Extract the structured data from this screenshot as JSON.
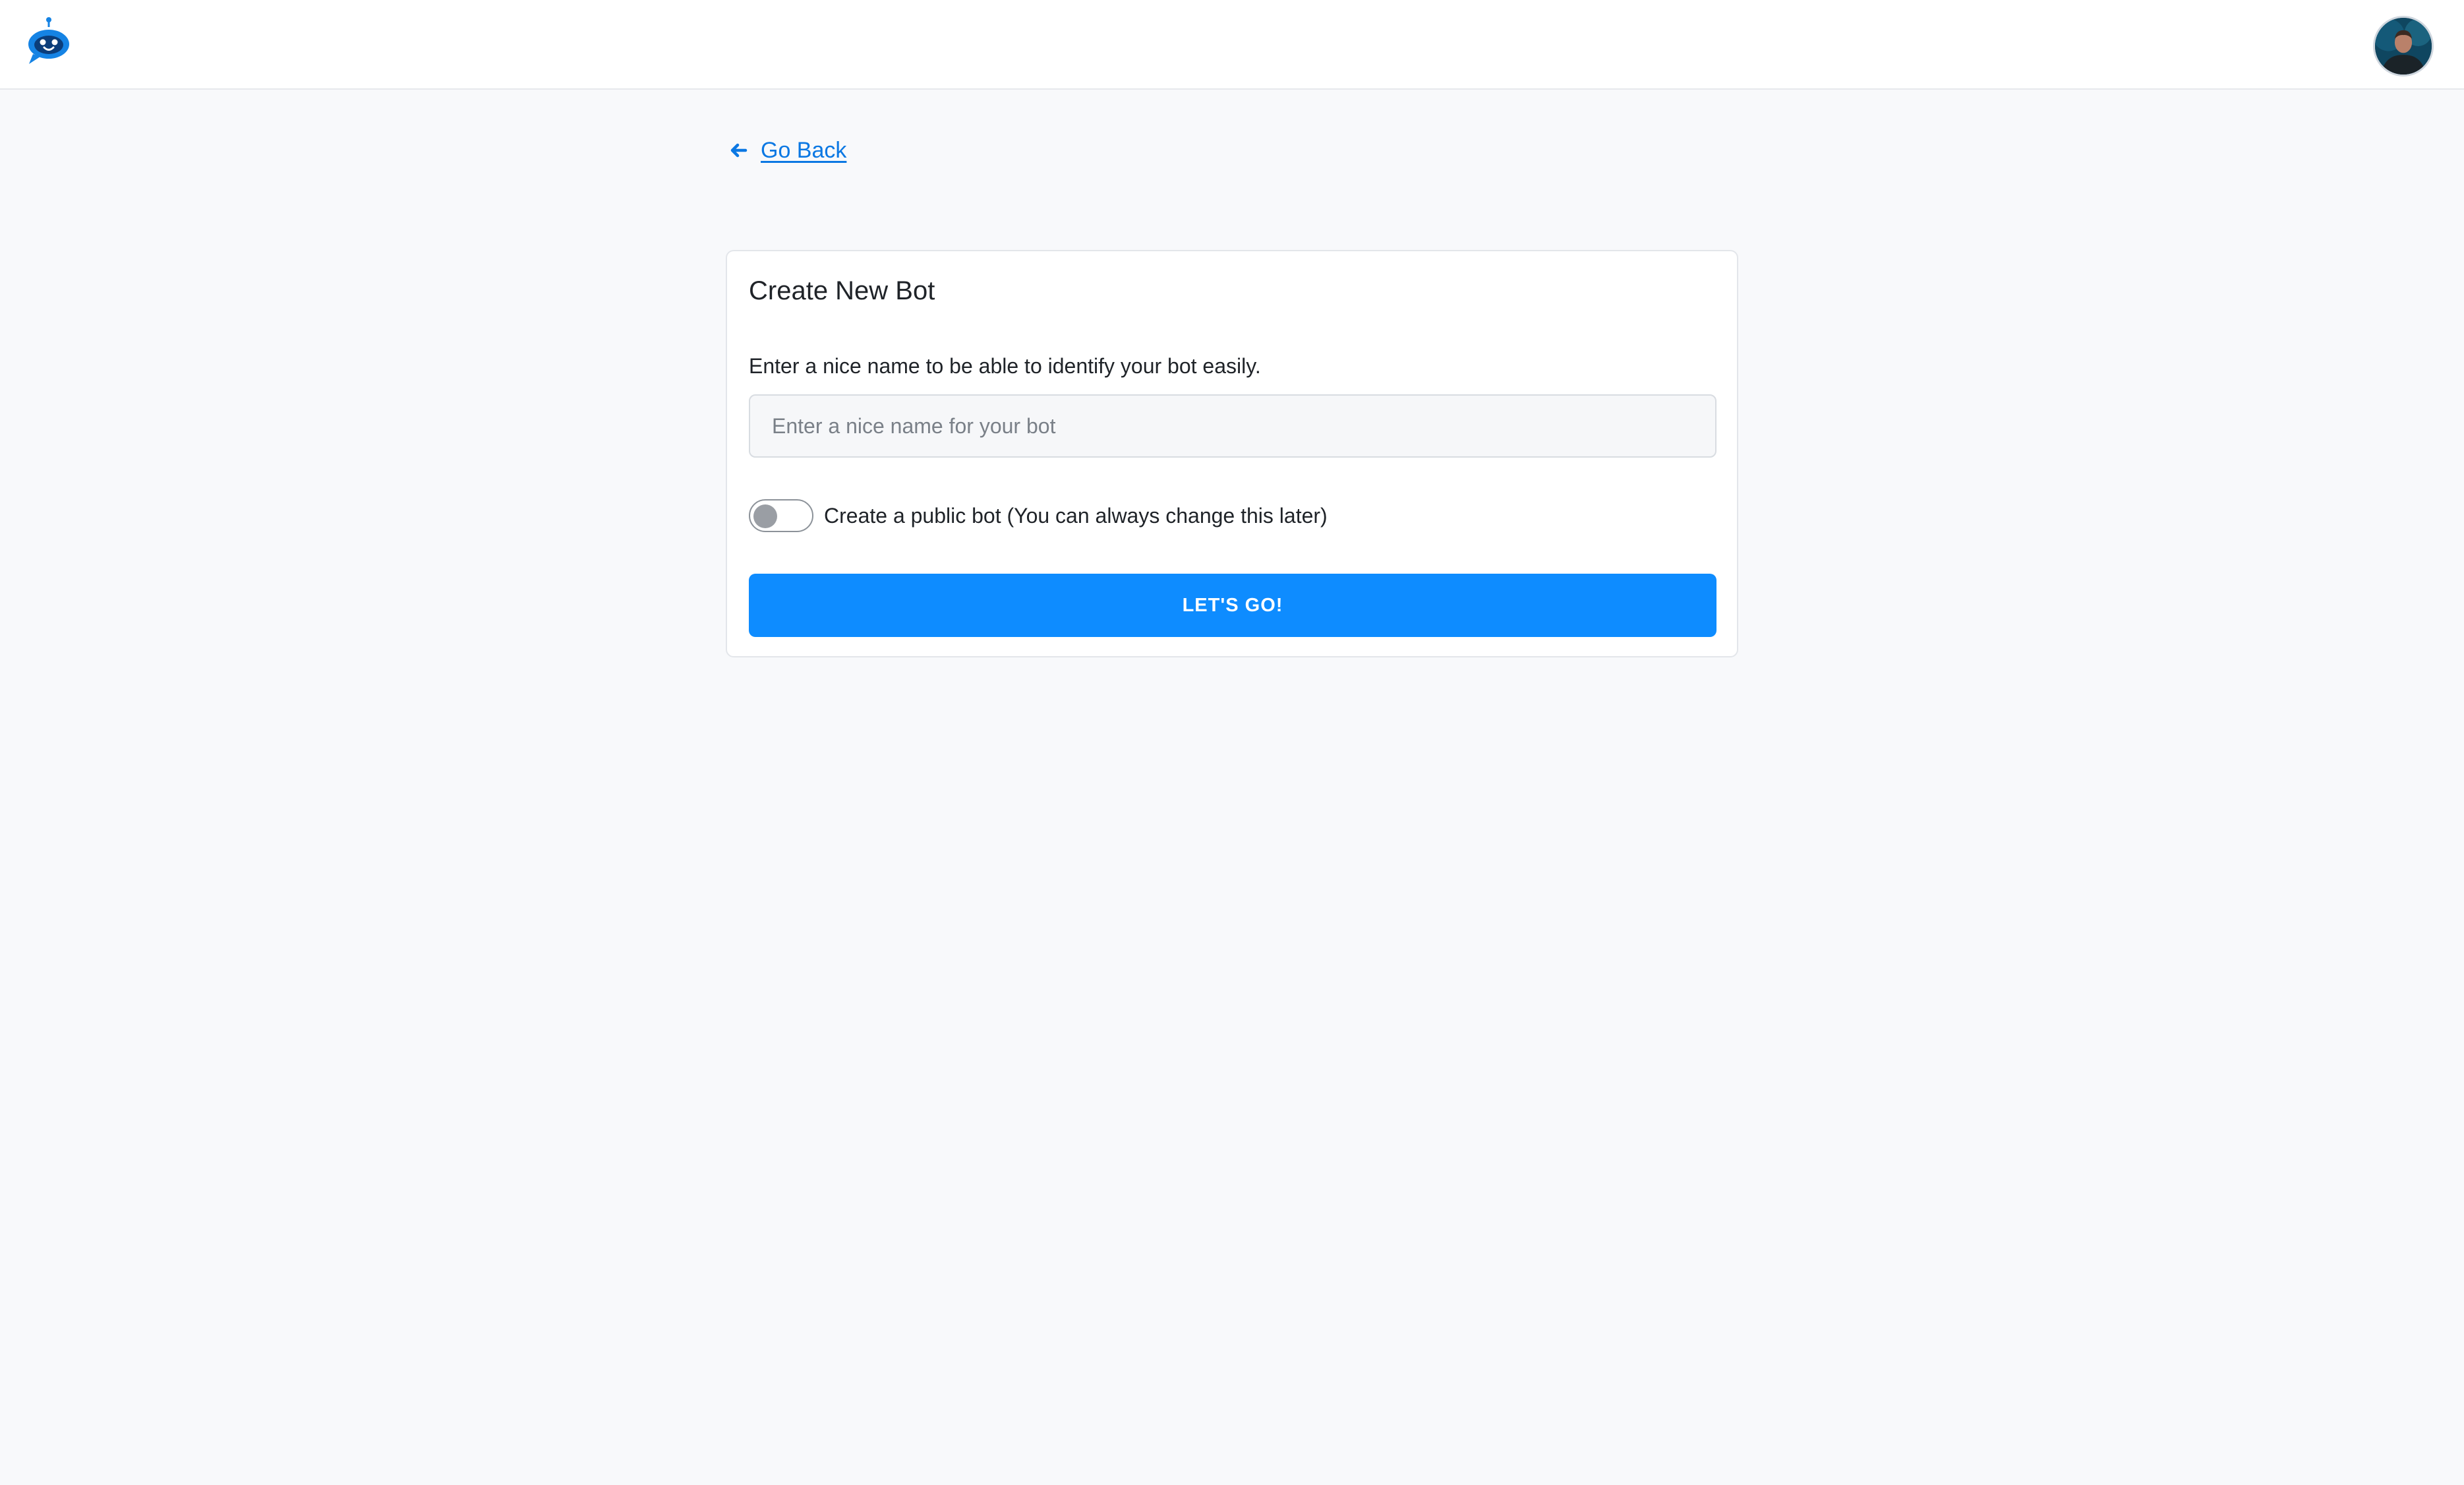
{
  "header": {
    "logo_icon": "robot-bot-logo-icon",
    "avatar": "user-profile-avatar"
  },
  "navigation": {
    "back_icon": "arrow-left-icon",
    "back_label": "Go Back"
  },
  "form": {
    "title": "Create New Bot",
    "name_label": "Enter a nice name to be able to identify your bot easily.",
    "name_value": "",
    "name_placeholder": "Enter a nice name for your bot",
    "public_toggle_state": "off",
    "public_toggle_label": "Create a public bot (You can always change this later)",
    "submit_label": "LET'S GO!"
  },
  "colors": {
    "accent": "#0e8cff",
    "link": "#0b78e3",
    "background": "#f8f9fb",
    "surface": "#ffffff",
    "border": "#e3e6ea",
    "toggle_knob": "#9a9ea4"
  }
}
